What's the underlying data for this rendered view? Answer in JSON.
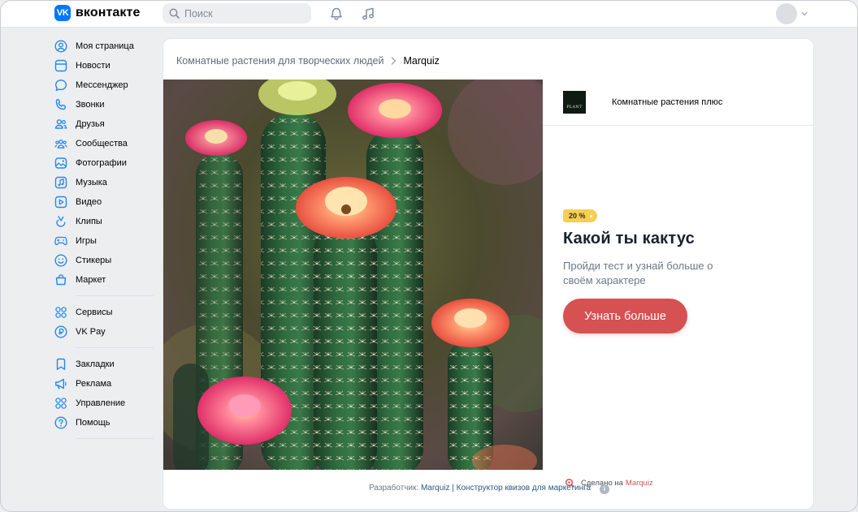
{
  "header": {
    "logo_text": "вконтакте",
    "logo_mark": "VK",
    "search_placeholder": "Поиск",
    "icons": [
      "bell-icon",
      "music-icon",
      "avatar",
      "chevron-down-icon"
    ]
  },
  "sidebar": {
    "groups": [
      [
        {
          "label": "Моя страница",
          "icon": "user-circle-icon"
        },
        {
          "label": "Новости",
          "icon": "newsfeed-icon"
        },
        {
          "label": "Мессенджер",
          "icon": "message-icon"
        },
        {
          "label": "Звонки",
          "icon": "phone-icon"
        },
        {
          "label": "Друзья",
          "icon": "friends-icon"
        },
        {
          "label": "Сообщества",
          "icon": "communities-icon"
        },
        {
          "label": "Фотографии",
          "icon": "photo-icon"
        },
        {
          "label": "Музыка",
          "icon": "music-icon"
        },
        {
          "label": "Видео",
          "icon": "video-icon"
        },
        {
          "label": "Клипы",
          "icon": "clips-icon"
        },
        {
          "label": "Игры",
          "icon": "gamepad-icon"
        },
        {
          "label": "Стикеры",
          "icon": "smile-icon"
        },
        {
          "label": "Маркет",
          "icon": "market-bag-icon"
        }
      ],
      [
        {
          "label": "Сервисы",
          "icon": "services-icon"
        },
        {
          "label": "VK Pay",
          "icon": "vkpay-icon"
        }
      ],
      [
        {
          "label": "Закладки",
          "icon": "bookmark-icon"
        },
        {
          "label": "Реклама",
          "icon": "megaphone-icon"
        },
        {
          "label": "Управление",
          "icon": "manage-icon"
        },
        {
          "label": "Помощь",
          "icon": "help-icon"
        }
      ]
    ]
  },
  "main": {
    "breadcrumb": {
      "parent": "Комнатные растения для творческих людей",
      "current": "Marquiz"
    },
    "brand_logo_text": "PLANT",
    "brand_name": "Комнатные растения плюс",
    "badge": "20 %",
    "title": "Какой ты кактус",
    "subtitle": "Пройди тест и узнай больше о своём характере",
    "cta": "Узнать больше",
    "made_prefix": "Сделано на",
    "made_link": "Marquiz",
    "developer_prefix": "Разработчик:",
    "developer_link": "Marquiz | Конструктор квизов для маркетинга",
    "info_icon": "i"
  },
  "colors": {
    "accent": "#0077ff",
    "cta": "#d65152",
    "badge": "#f5cf52",
    "link": "#2a5885"
  }
}
